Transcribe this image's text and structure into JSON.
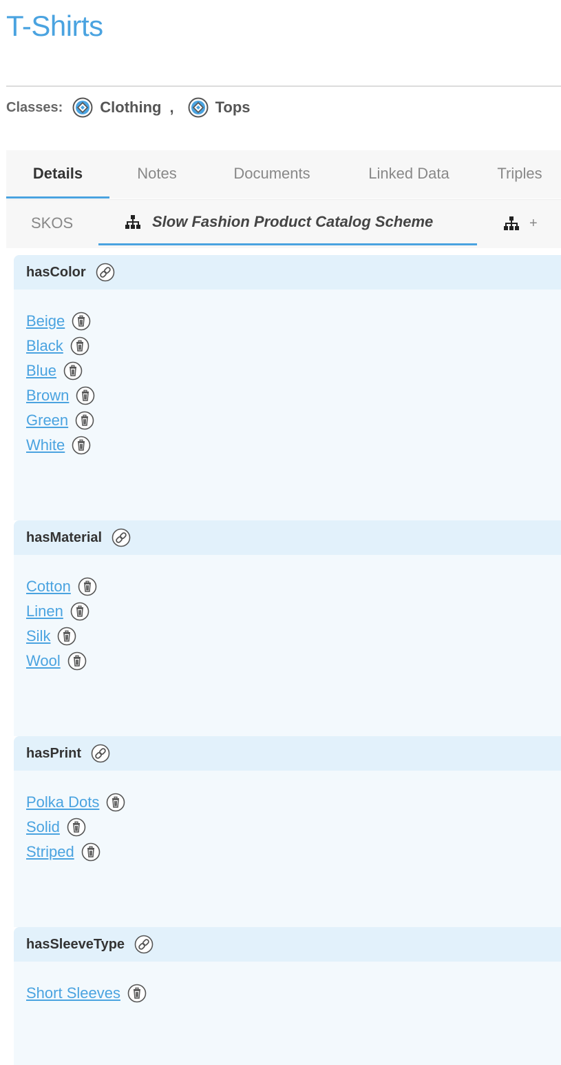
{
  "page": {
    "title": "T-Shirts"
  },
  "classes": {
    "label": "Classes:",
    "items": [
      "Clothing",
      "Tops"
    ],
    "separator": ","
  },
  "tabs": [
    "Details",
    "Notes",
    "Documents",
    "Linked Data",
    "Triples"
  ],
  "active_tab": "Details",
  "subtabs": {
    "skos": "SKOS",
    "scheme": "Slow Fashion Product Catalog Scheme",
    "add": "+"
  },
  "sections": [
    {
      "title": "hasColor",
      "values": [
        "Beige",
        "Black",
        "Blue",
        "Brown",
        "Green",
        "White"
      ]
    },
    {
      "title": "hasMaterial",
      "values": [
        "Cotton",
        "Linen",
        "Silk",
        "Wool"
      ]
    },
    {
      "title": "hasPrint",
      "values": [
        "Polka Dots",
        "Solid",
        "Striped"
      ]
    },
    {
      "title": "hasSleeveType",
      "values": [
        "Short Sleeves"
      ]
    }
  ],
  "colors": {
    "accent": "#4aa3e0",
    "header_bg": "#e2f1fb",
    "body_bg": "#f3f9fd"
  }
}
